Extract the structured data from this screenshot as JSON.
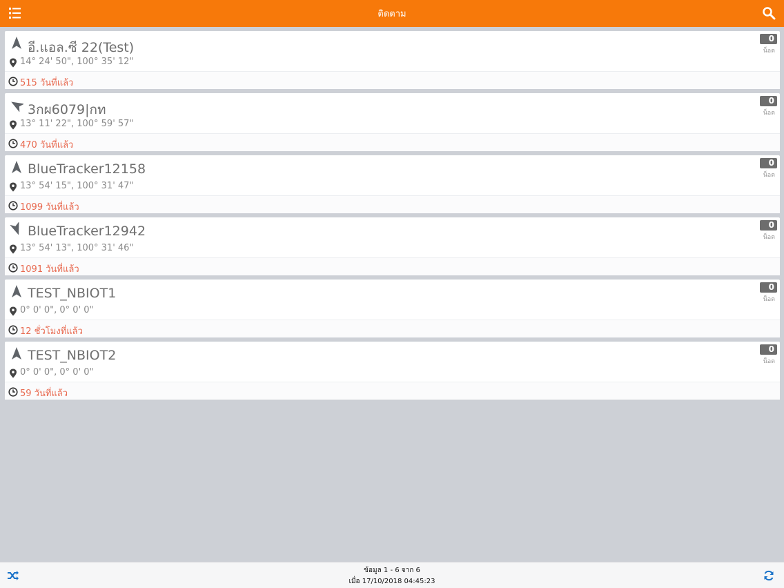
{
  "header": {
    "title": "ติดตาม",
    "menu_icon": "list-icon",
    "search_icon": "search-icon",
    "bar_color": "#f7790a"
  },
  "devices": [
    {
      "name": "อี.แอล.ซี 22(Test)",
      "coordinates": "14° 24' 50\", 100° 35' 12\"",
      "last_seen": "515 วันที่แล้ว",
      "count": "0",
      "count_label": "น็อต",
      "heading_deg": 0
    },
    {
      "name": "3กผ6079|กท",
      "coordinates": "13° 11' 22\", 100° 59' 57\"",
      "last_seen": "470 วันที่แล้ว",
      "count": "0",
      "count_label": "น็อต",
      "heading_deg": -60
    },
    {
      "name": "BlueTracker12158",
      "coordinates": "13° 54' 15\", 100° 31' 47\"",
      "last_seen": "1099 วันที่แล้ว",
      "count": "0",
      "count_label": "น็อต",
      "heading_deg": 0
    },
    {
      "name": "BlueTracker12942",
      "coordinates": "13° 54' 13\", 100° 31' 46\"",
      "last_seen": "1091 วันที่แล้ว",
      "count": "0",
      "count_label": "น็อต",
      "heading_deg": 160
    },
    {
      "name": "TEST_NBIOT1",
      "coordinates": "0° 0' 0\", 0° 0' 0\"",
      "last_seen": "12 ชั่วโมงที่แล้ว",
      "count": "0",
      "count_label": "น็อต",
      "heading_deg": 0
    },
    {
      "name": "TEST_NBIOT2",
      "coordinates": "0° 0' 0\", 0° 0' 0\"",
      "last_seen": "59 วันที่แล้ว",
      "count": "0",
      "count_label": "น็อต",
      "heading_deg": 0
    }
  ],
  "footer": {
    "records": "ข้อมูล 1 - 6 จาก 6",
    "updated": "เมื่อ 17/10/2018 04:45:23",
    "shuffle_icon": "shuffle-icon",
    "refresh_icon": "refresh-icon",
    "accent": "#1a73c9"
  }
}
